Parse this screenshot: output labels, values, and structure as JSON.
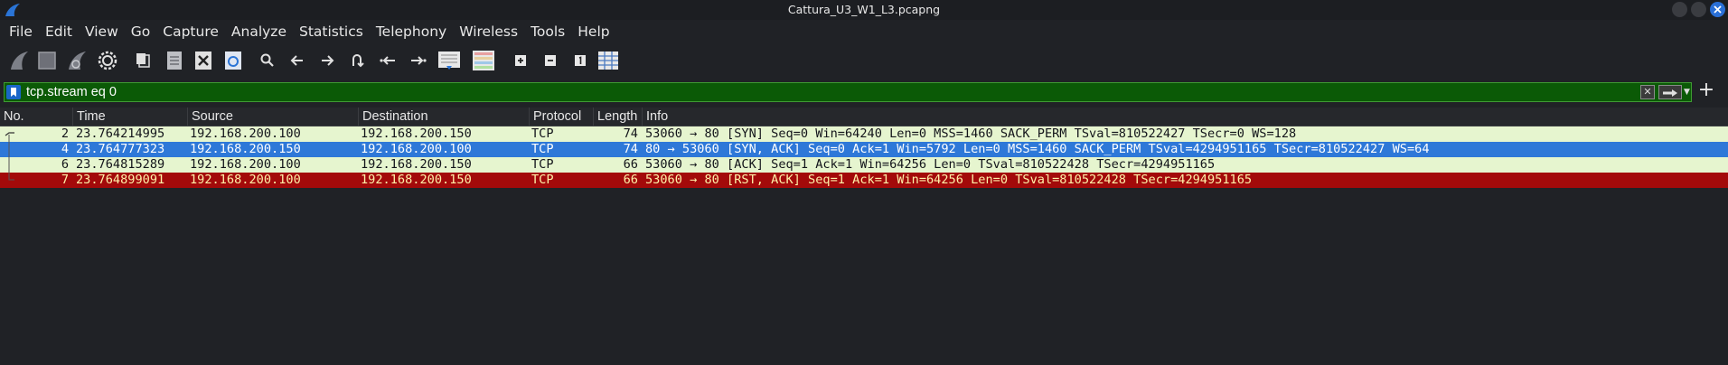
{
  "window": {
    "title": "Cattura_U3_W1_L3.pcapng"
  },
  "menu": [
    "File",
    "Edit",
    "View",
    "Go",
    "Capture",
    "Analyze",
    "Statistics",
    "Telephony",
    "Wireless",
    "Tools",
    "Help"
  ],
  "toolbar": {
    "icons": [
      "start-capture-icon",
      "stop-capture-icon",
      "restart-capture-icon",
      "capture-options-icon",
      "open-file-icon",
      "save-file-icon",
      "close-file-icon",
      "reload-file-icon",
      "find-packet-icon",
      "go-back-icon",
      "go-forward-icon",
      "go-to-packet-icon",
      "go-first-packet-icon",
      "go-last-packet-icon",
      "autoscroll-icon",
      "colorize-icon",
      "zoom-in-icon",
      "zoom-out-icon",
      "normal-size-icon",
      "resize-columns-icon"
    ]
  },
  "filter": {
    "value": "tcp.stream eq 0"
  },
  "columns": {
    "no": "No.",
    "time": "Time",
    "source": "Source",
    "destination": "Destination",
    "protocol": "Protocol",
    "length": "Length",
    "info": "Info"
  },
  "packets": [
    {
      "no": "2",
      "time": "23.764214995",
      "source": "192.168.200.100",
      "destination": "192.168.200.150",
      "protocol": "TCP",
      "length": "74",
      "info": "53060 → 80 [SYN] Seq=0 Win=64240 Len=0 MSS=1460 SACK_PERM TSval=810522427 TSecr=0 WS=128"
    },
    {
      "no": "4",
      "time": "23.764777323",
      "source": "192.168.200.150",
      "destination": "192.168.200.100",
      "protocol": "TCP",
      "length": "74",
      "info": "80 → 53060 [SYN, ACK] Seq=0 Ack=1 Win=5792 Len=0 MSS=1460 SACK_PERM TSval=4294951165 TSecr=810522427 WS=64"
    },
    {
      "no": "6",
      "time": "23.764815289",
      "source": "192.168.200.100",
      "destination": "192.168.200.150",
      "protocol": "TCP",
      "length": "66",
      "info": "53060 → 80 [ACK] Seq=1 Ack=1 Win=64256 Len=0 TSval=810522428 TSecr=4294951165"
    },
    {
      "no": "7",
      "time": "23.764899091",
      "source": "192.168.200.100",
      "destination": "192.168.200.150",
      "protocol": "TCP",
      "length": "66",
      "info": "53060 → 80 [RST, ACK] Seq=1 Ack=1 Win=64256 Len=0 TSval=810522428 TSecr=4294951165"
    }
  ],
  "colors": {
    "syn_row": "#e6f5cf",
    "selected_row": "#2e78d8",
    "rst_row": "#a30a0a",
    "filter_valid": "#0b5a06"
  }
}
